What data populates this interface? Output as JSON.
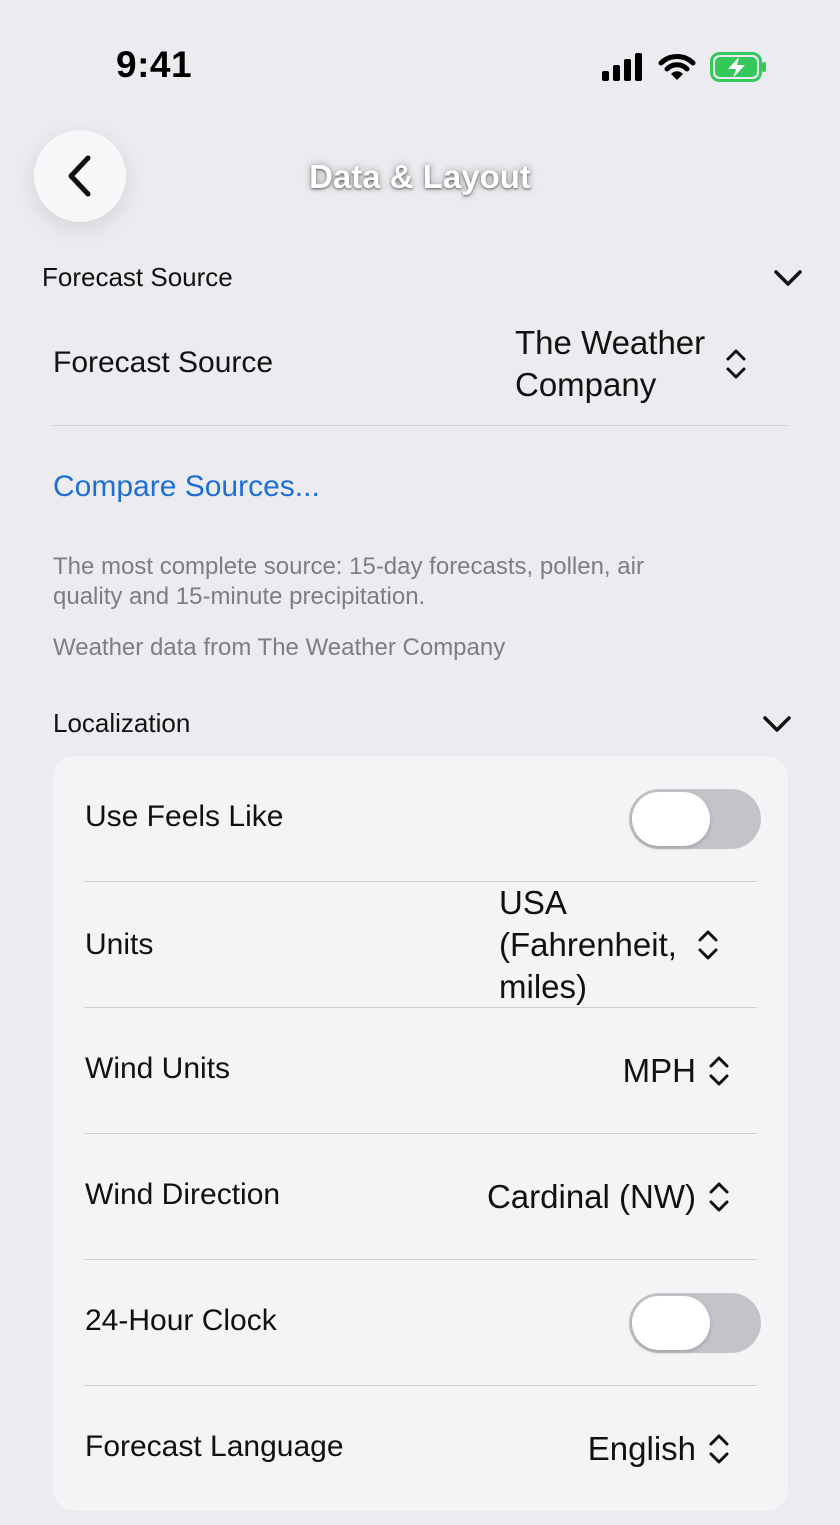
{
  "status_bar": {
    "time": "9:41"
  },
  "nav": {
    "title": "Data & Layout"
  },
  "forecast_section": {
    "header": "Forecast Source",
    "row_label": "Forecast Source",
    "value_line1": "The Weather",
    "value_line2": "Company",
    "compare_link": "Compare Sources...",
    "note_line1": "The most complete source: 15-day forecasts, pollen, air",
    "note_line2": "quality and 15-minute precipitation.",
    "attribution": "Weather data from The Weather Company"
  },
  "localization": {
    "header": "Localization",
    "feels_like": {
      "label": "Use Feels Like",
      "on": false
    },
    "units": {
      "label": "Units",
      "line1": "USA",
      "line2": "(Fahrenheit,",
      "line3": "miles)"
    },
    "wind_units": {
      "label": "Wind Units",
      "value": "MPH"
    },
    "wind_direction": {
      "label": "Wind Direction",
      "value": "Cardinal (NW)"
    },
    "clock": {
      "label": "24-Hour Clock",
      "on": false
    },
    "language": {
      "label": "Forecast Language",
      "value": "English"
    }
  },
  "colors": {
    "accent": "#1d6fd6",
    "battery": "#34c759",
    "background": "#ececf0",
    "card": "#f4f4f6"
  }
}
